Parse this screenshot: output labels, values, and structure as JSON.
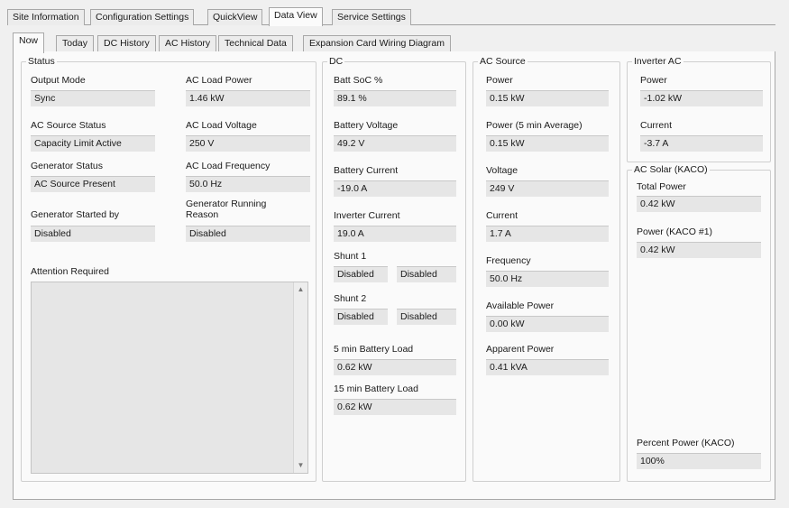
{
  "top_tabs": [
    {
      "label": "Site Information"
    },
    {
      "label": "Configuration Settings"
    },
    {
      "label": "QuickView"
    },
    {
      "label": "Data View"
    },
    {
      "label": "Service Settings"
    }
  ],
  "sub_tabs": [
    {
      "label": "Now"
    },
    {
      "label": "Today"
    },
    {
      "label": "DC History"
    },
    {
      "label": "AC History"
    },
    {
      "label": "Technical Data"
    },
    {
      "label": "Expansion Card Wiring Diagram"
    }
  ],
  "status": {
    "title": "Status",
    "output_mode": {
      "label": "Output Mode",
      "value": "Sync"
    },
    "ac_source_status": {
      "label": "AC Source Status",
      "value": "Capacity Limit Active"
    },
    "generator_status": {
      "label": "Generator Status",
      "value": "AC Source Present"
    },
    "generator_started_by": {
      "label": "Generator Started by",
      "value": "Disabled"
    },
    "ac_load_power": {
      "label": "AC Load Power",
      "value": "1.46 kW"
    },
    "ac_load_voltage": {
      "label": "AC Load Voltage",
      "value": "250 V"
    },
    "ac_load_frequency": {
      "label": "AC Load Frequency",
      "value": "50.0 Hz"
    },
    "generator_running_reason": {
      "label": "Generator Running Reason",
      "value": "Disabled"
    },
    "attention_required": {
      "label": "Attention Required"
    }
  },
  "dc": {
    "title": "DC",
    "batt_soc": {
      "label": "Batt SoC %",
      "value": "89.1 %"
    },
    "battery_voltage": {
      "label": "Battery Voltage",
      "value": "49.2 V"
    },
    "battery_current": {
      "label": "Battery Current",
      "value": "-19.0 A"
    },
    "inverter_current": {
      "label": "Inverter Current",
      "value": "19.0 A"
    },
    "shunt1": {
      "label": "Shunt 1",
      "value1": "Disabled",
      "value2": "Disabled"
    },
    "shunt2": {
      "label": "Shunt 2",
      "value1": "Disabled",
      "value2": "Disabled"
    },
    "battery_load_5": {
      "label": "5 min Battery Load",
      "value": "0.62 kW"
    },
    "battery_load_15": {
      "label": "15 min Battery Load",
      "value": "0.62 kW"
    }
  },
  "ac_source": {
    "title": "AC Source",
    "power": {
      "label": "Power",
      "value": "0.15 kW"
    },
    "power_avg": {
      "label": "Power (5 min Average)",
      "value": "0.15 kW"
    },
    "voltage": {
      "label": "Voltage",
      "value": "249 V"
    },
    "current": {
      "label": "Current",
      "value": "1.7 A"
    },
    "frequency": {
      "label": "Frequency",
      "value": "50.0 Hz"
    },
    "available_power": {
      "label": "Available Power",
      "value": "0.00 kW"
    },
    "apparent_power": {
      "label": "Apparent Power",
      "value": "0.41 kVA"
    }
  },
  "inverter_ac": {
    "title": "Inverter AC",
    "power": {
      "label": "Power",
      "value": "-1.02 kW"
    },
    "current": {
      "label": "Current",
      "value": "-3.7 A"
    }
  },
  "ac_solar": {
    "title": "AC Solar (KACO)",
    "total_power": {
      "label": "Total Power",
      "value": "0.42 kW"
    },
    "power_kaco1": {
      "label": "Power (KACO #1)",
      "value": "0.42 kW"
    },
    "percent_power": {
      "label": "Percent Power (KACO)",
      "value": "100%"
    }
  }
}
